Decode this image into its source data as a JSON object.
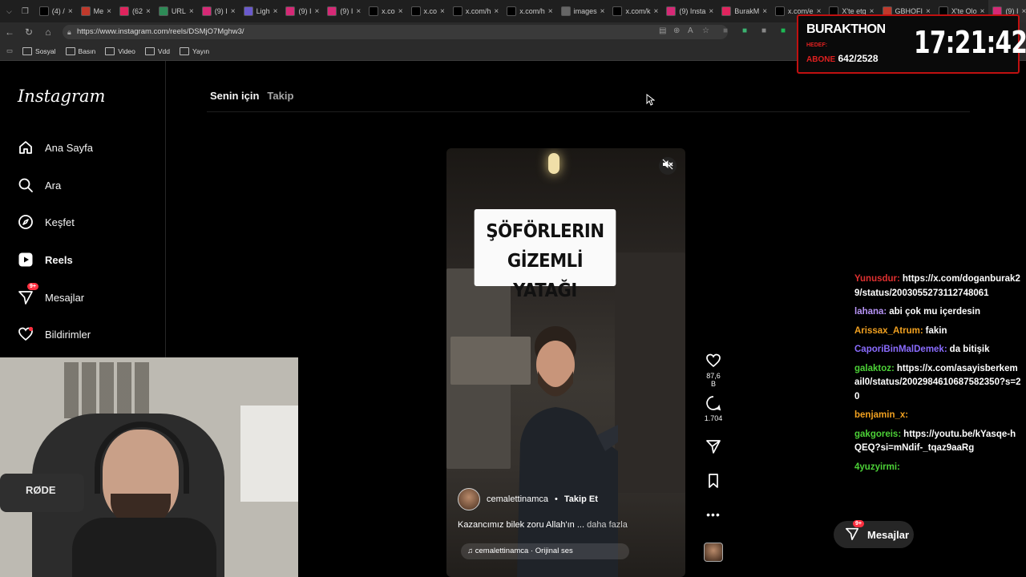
{
  "browser": {
    "tabs": [
      {
        "label": "(4) /",
        "color": "#000"
      },
      {
        "label": "Me",
        "color": "#c0392b"
      },
      {
        "label": "(62",
        "color": "#e0245e"
      },
      {
        "label": "URL",
        "color": "#2e8b57"
      },
      {
        "label": "(9) I",
        "color": "#d62976"
      },
      {
        "label": "Ligh",
        "color": "#6a5acd"
      },
      {
        "label": "(9) I",
        "color": "#d62976"
      },
      {
        "label": "(9) I",
        "color": "#d62976"
      },
      {
        "label": "x.co",
        "color": "#000"
      },
      {
        "label": "x.co",
        "color": "#000"
      },
      {
        "label": "x.com/h",
        "color": "#000"
      },
      {
        "label": "x.com/h",
        "color": "#000"
      },
      {
        "label": "images",
        "color": "#666"
      },
      {
        "label": "x.com/k",
        "color": "#000"
      },
      {
        "label": "(9) Insta",
        "color": "#d62976"
      },
      {
        "label": "BurakM",
        "color": "#e0245e"
      },
      {
        "label": "x.com/e",
        "color": "#000"
      },
      {
        "label": "X'te etg",
        "color": "#000"
      },
      {
        "label": "GBHOFI",
        "color": "#c0392b"
      },
      {
        "label": "X'te Olo",
        "color": "#000"
      },
      {
        "label": "(9) I",
        "color": "#d62976"
      }
    ],
    "url": "https://www.instagram.com/reels/DSMjO7Mghw3/",
    "bookmarks": [
      "Sosyal",
      "Basın",
      "Video",
      "Vdd",
      "Yayın"
    ]
  },
  "instagram": {
    "logo": "Instagram",
    "nav": [
      {
        "label": "Ana Sayfa",
        "icon": "home-icon"
      },
      {
        "label": "Ara",
        "icon": "search-icon"
      },
      {
        "label": "Keşfet",
        "icon": "compass-icon"
      },
      {
        "label": "Reels",
        "icon": "reels-icon"
      },
      {
        "label": "Mesajlar",
        "icon": "messenger-icon",
        "badge": "9+"
      },
      {
        "label": "Bildirimler",
        "icon": "heart-icon"
      }
    ],
    "feed_tabs": {
      "for_you": "Senin için",
      "following": "Takip"
    },
    "reel": {
      "caption_line1": "ŞÖFÖRLERIN",
      "caption_line2": "GİZEMLİ YATAĞI",
      "author": "cemalettinamca",
      "separator": "•",
      "follow": "Takip Et",
      "description": "Kazancımız bilek zoru Allah'ın ...",
      "more": "daha fazla",
      "audio": "cemalettinamca · Orijinal ses",
      "likes": "87,6 B",
      "comments": "1.704"
    },
    "dm_button": {
      "label": "Mesajlar",
      "badge": "9+"
    }
  },
  "overlay": {
    "webcam_label": "RØDE",
    "stream_title": "BURAKTHON",
    "hedef_label": "HEDEF:",
    "abone_label": "ABONE",
    "abone_count": "642/2528",
    "timer": "17:21:42"
  },
  "chat": [
    {
      "user": "Yunusdur:",
      "color": "#e03030",
      "text": "https://x.com/doganburak29/status/2003055273112748061"
    },
    {
      "user": "lahana:",
      "color": "#b794f6",
      "text": "abi çok mu içerdesin"
    },
    {
      "user": "Arissax_Atrum:",
      "color": "#f0a020",
      "text": "fakin"
    },
    {
      "user": "CaporiBinMalDemek:",
      "color": "#8a6cff",
      "text": "da bitişik"
    },
    {
      "user": "galaktoz:",
      "color": "#4cd137",
      "text": "https://x.com/asayisberkemail0/status/2002984610687582350?s=20"
    },
    {
      "user": "benjamin_x:",
      "color": "#f0a020",
      "text": ""
    },
    {
      "user": "gakgoreis:",
      "color": "#4cd137",
      "text": "https://youtu.be/kYasqe-hQEQ?si=mNdif-_tqaz9aaRg"
    },
    {
      "user": "4yuzyirmi:",
      "color": "#4cd137",
      "text": ""
    }
  ]
}
